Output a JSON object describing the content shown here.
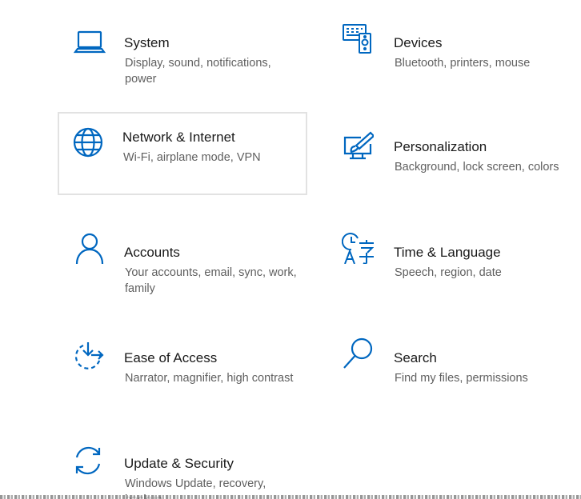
{
  "accent_color": "#0067c0",
  "tiles": [
    {
      "id": "system",
      "icon": "laptop-icon",
      "title": "System",
      "description": "Display, sound, notifications, power"
    },
    {
      "id": "devices",
      "icon": "devices-icon",
      "title": "Devices",
      "description": "Bluetooth, printers, mouse"
    },
    {
      "id": "network",
      "icon": "globe-icon",
      "title": "Network & Internet",
      "description": "Wi-Fi, airplane mode, VPN"
    },
    {
      "id": "personalization",
      "icon": "paint-brush-icon",
      "title": "Personalization",
      "description": "Background, lock screen, colors"
    },
    {
      "id": "accounts",
      "icon": "person-icon",
      "title": "Accounts",
      "description": "Your accounts, email, sync, work, family"
    },
    {
      "id": "time-language",
      "icon": "time-language-icon",
      "title": "Time & Language",
      "description": "Speech, region, date"
    },
    {
      "id": "ease-of-access",
      "icon": "ease-of-access-icon",
      "title": "Ease of Access",
      "description": "Narrator, magnifier, high contrast"
    },
    {
      "id": "search",
      "icon": "search-icon",
      "title": "Search",
      "description": "Find my files, permissions"
    },
    {
      "id": "update-security",
      "icon": "update-sync-icon",
      "title": "Update & Security",
      "description": "Windows Update, recovery, backup"
    }
  ]
}
